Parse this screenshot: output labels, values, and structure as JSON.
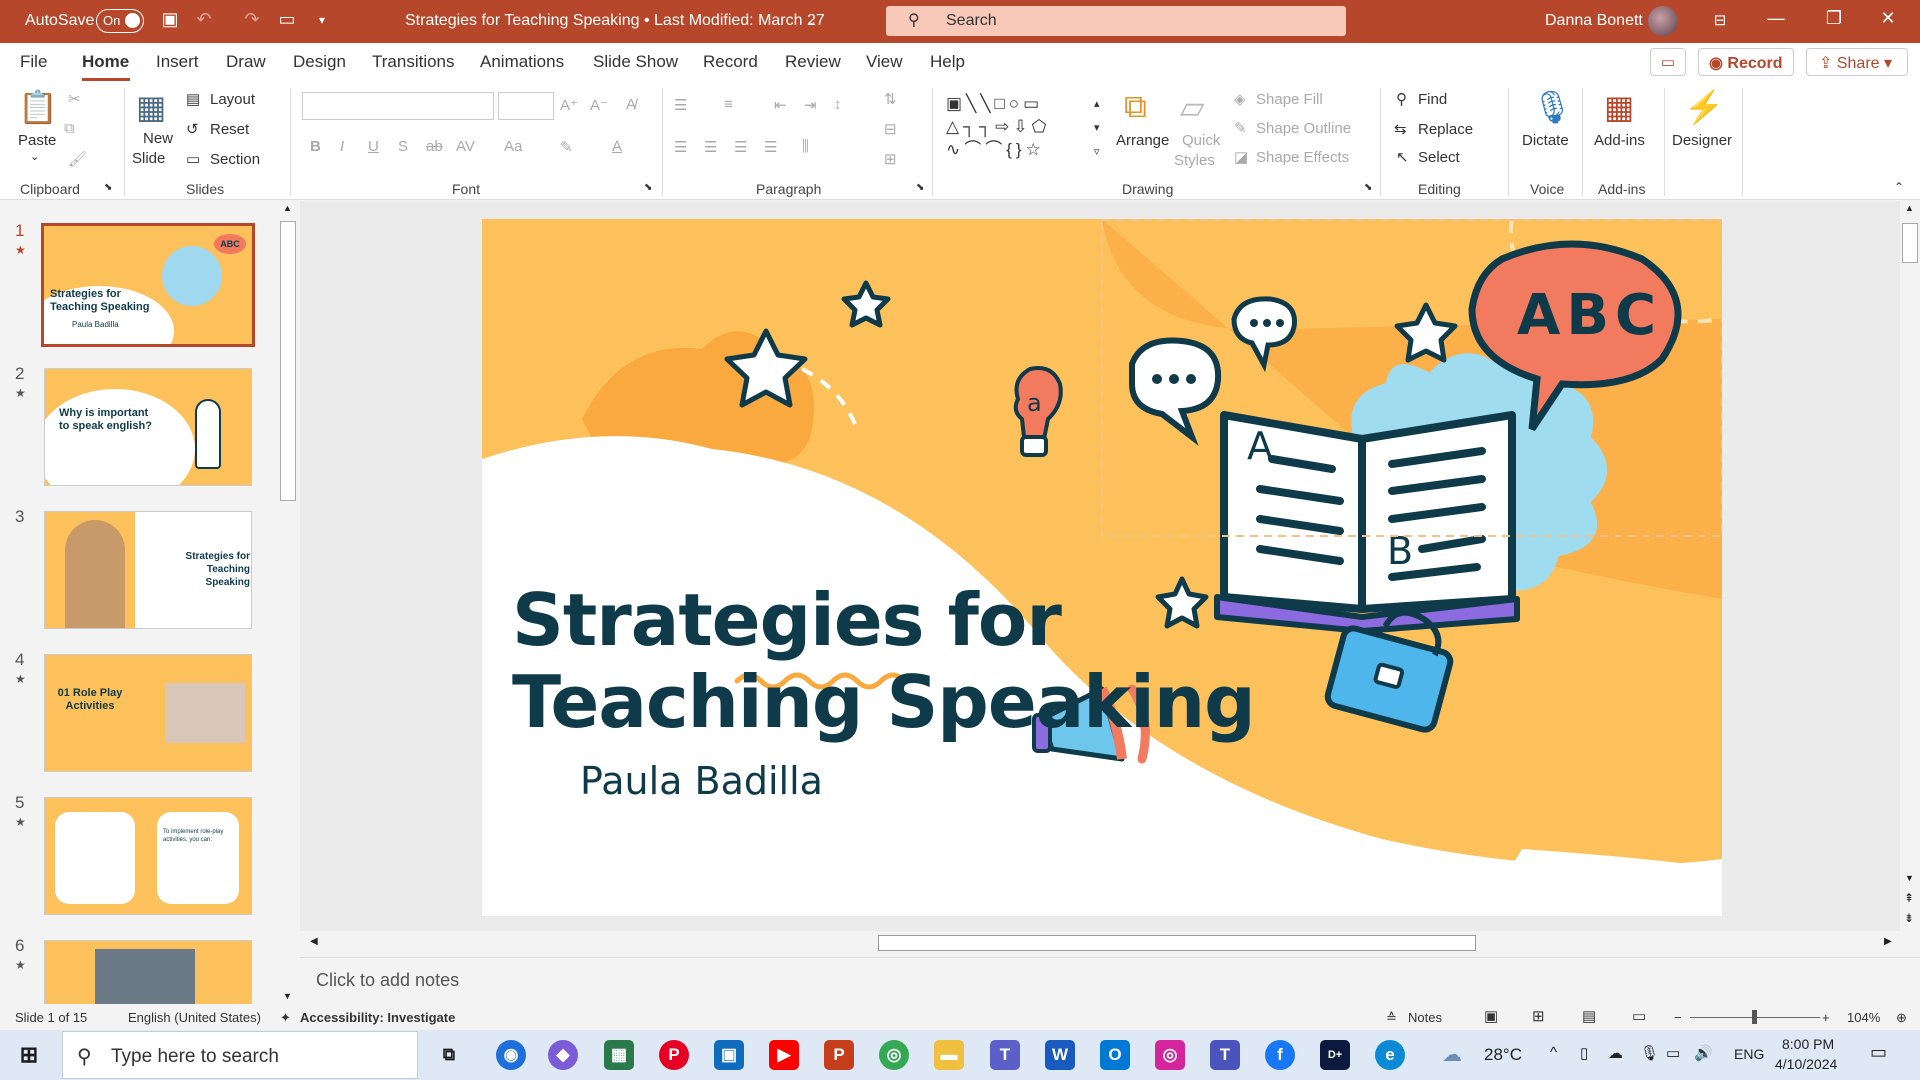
{
  "titlebar": {
    "autosave_label": "AutoSave",
    "autosave_state": "On",
    "doc_title": "Strategies for Teaching Speaking • Last Modified: March 27",
    "search_placeholder": "Search",
    "user_name": "Danna Bonett"
  },
  "menu": {
    "items": [
      "File",
      "Home",
      "Insert",
      "Draw",
      "Design",
      "Transitions",
      "Animations",
      "Slide Show",
      "Record",
      "Review",
      "View",
      "Help"
    ],
    "active": "Home",
    "record_label": "Record",
    "share_label": "Share"
  },
  "ribbon": {
    "clipboard": {
      "paste": "Paste",
      "group": "Clipboard"
    },
    "slides": {
      "new_slide": "New",
      "new_slide2": "Slide",
      "layout": "Layout",
      "reset": "Reset",
      "section": "Section",
      "group": "Slides"
    },
    "font": {
      "group": "Font"
    },
    "paragraph": {
      "group": "Paragraph"
    },
    "drawing": {
      "arrange": "Arrange",
      "quick_styles": "Quick",
      "quick_styles2": "Styles",
      "shape_fill": "Shape Fill",
      "shape_outline": "Shape Outline",
      "shape_effects": "Shape Effects",
      "group": "Drawing"
    },
    "editing": {
      "find": "Find",
      "replace": "Replace",
      "select": "Select",
      "group": "Editing"
    },
    "voice": {
      "dictate": "Dictate",
      "group": "Voice"
    },
    "addins": {
      "addins": "Add-ins",
      "group": "Add-ins"
    },
    "designer": {
      "label": "Designer"
    }
  },
  "thumbnails": [
    {
      "num": "1",
      "title": "Strategies for Teaching Speaking",
      "sub": "Paula Badilla"
    },
    {
      "num": "2",
      "title": "Why is important to speak english?"
    },
    {
      "num": "3",
      "title": "Strategies for Teaching Speaking"
    },
    {
      "num": "4",
      "title": "01 Role Play Activities"
    },
    {
      "num": "5",
      "title": "To implement role-play activities, you can:"
    },
    {
      "num": "6",
      "title": ""
    }
  ],
  "slide": {
    "title_line1": "Strategies for",
    "title_line2": "Teaching Speaking",
    "subtitle": "Paula Badilla",
    "bubble_text": "ABC",
    "book_a": "A",
    "book_b": "B",
    "bulb_letter": "a"
  },
  "notes_placeholder": "Click to add notes",
  "status": {
    "slide_count": "Slide 1 of 15",
    "language": "English (United States)",
    "accessibility": "Accessibility: Investigate",
    "notes": "Notes",
    "zoom": "104%"
  },
  "taskbar": {
    "search_placeholder": "Type here to search",
    "weather": "28°C",
    "lang": "ENG",
    "time": "8:00 PM",
    "date": "4/10/2024"
  },
  "colors": {
    "accent": "#b7472a",
    "slide_bg": "#fdc15b",
    "dark_text": "#0e3a4a"
  }
}
